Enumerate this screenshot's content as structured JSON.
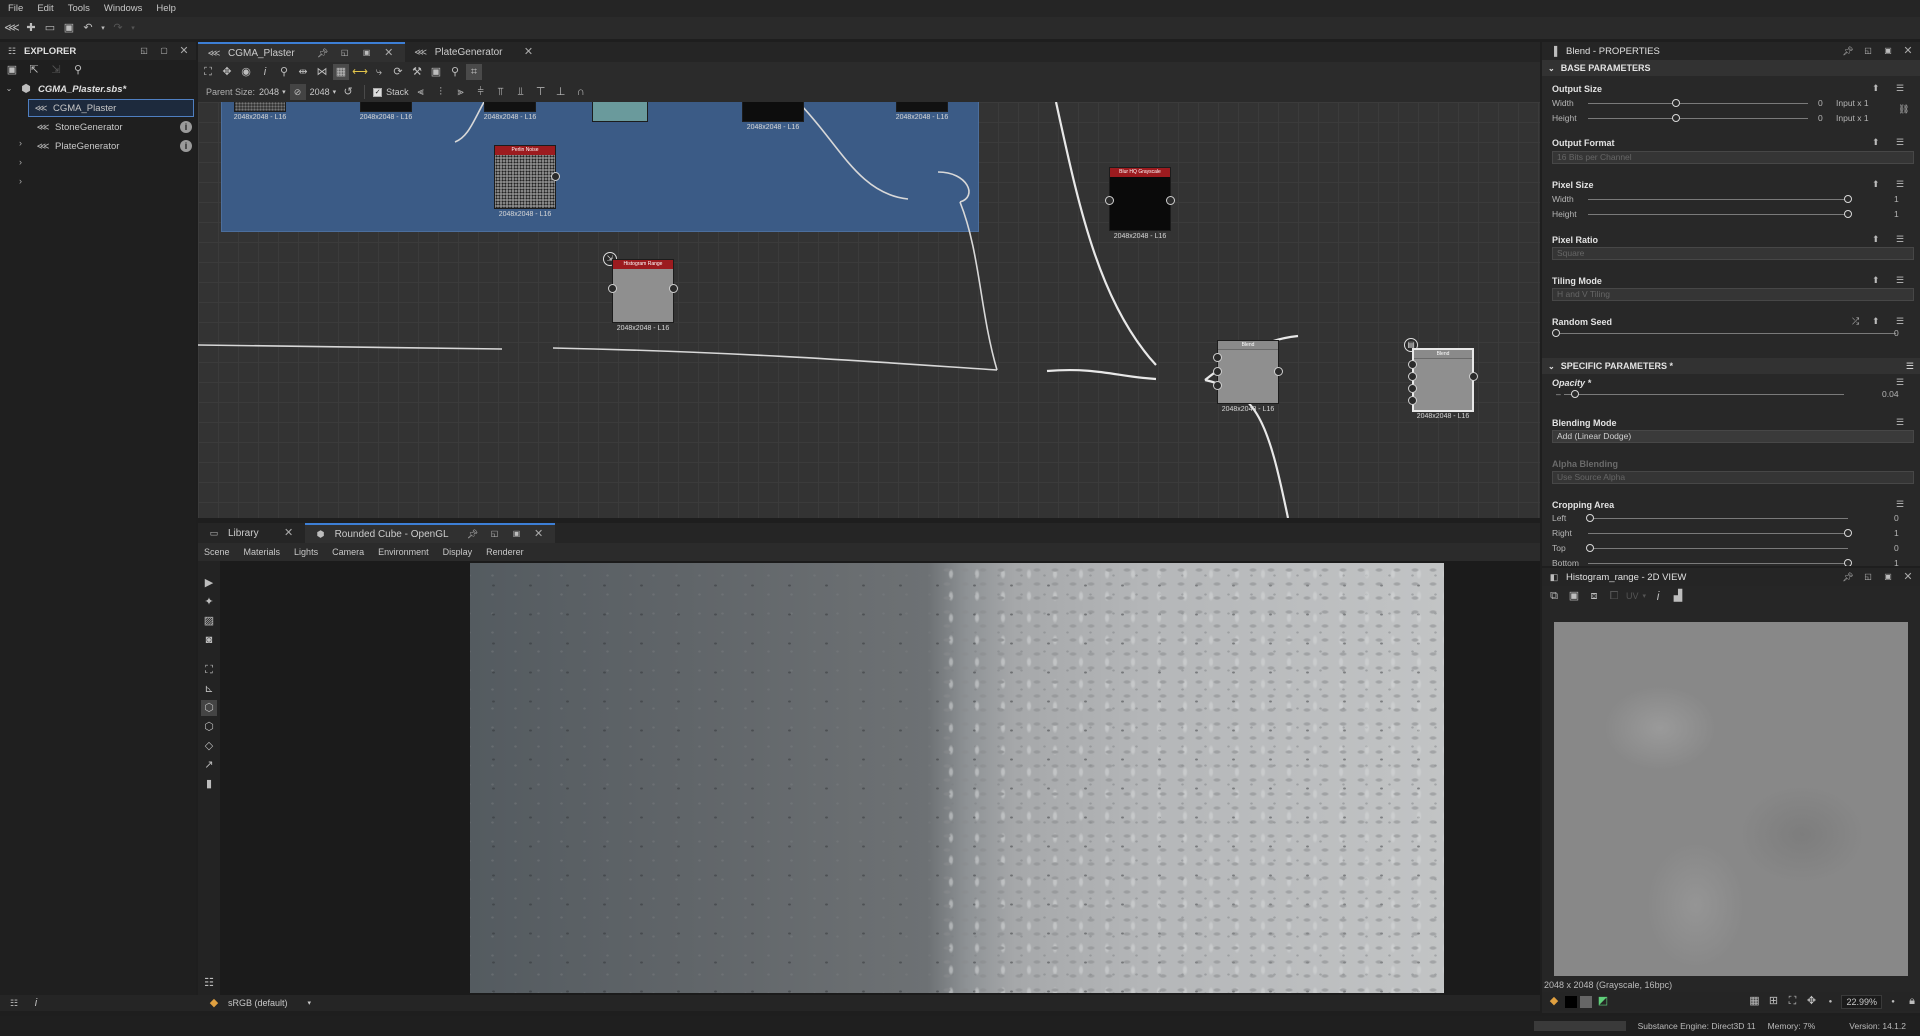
{
  "menu": [
    "File",
    "Edit",
    "Tools",
    "Windows",
    "Help"
  ],
  "explorer": {
    "title": "EXPLORER",
    "package": "CGMA_Plaster.sbs*",
    "items": [
      "CGMA_Plaster",
      "StoneGenerator",
      "PlateGenerator"
    ]
  },
  "graph": {
    "tabs": [
      "CGMA_Plaster",
      "PlateGenerator"
    ],
    "parent_size_label": "Parent Size:",
    "parent_size_value": "2048",
    "size_value": "2048",
    "stack_label": "Stack",
    "nodes": {
      "top1_cap": "2048x2048 - L16",
      "top2_cap": "2048x2048 - L16",
      "top3_cap": "2048x2048 - L16",
      "top4_cap": "2048x2048 - L16",
      "top5_cap": "2048x2048 - L16",
      "perlin_title": "Perlin Noise",
      "perlin_cap": "2048x2048 - L16",
      "blur_title": "Blur HQ Grayscale",
      "blur_cap": "2048x2048 - L16",
      "histo_title": "Histogram Range",
      "histo_cap": "2048x2048 - L16",
      "blend1_title": "Blend",
      "blend1_cap": "2048x2048 - L16",
      "blend2_title": "Blend",
      "blend2_cap": "2048x2048 - L16"
    }
  },
  "viewport": {
    "tabs": [
      "Library",
      "Rounded Cube - OpenGL"
    ],
    "menu": [
      "Scene",
      "Materials",
      "Lights",
      "Camera",
      "Environment",
      "Display",
      "Renderer"
    ],
    "colorspace": "sRGB (default)"
  },
  "properties": {
    "title": "Blend - PROPERTIES",
    "base_section": "BASE PARAMETERS",
    "output_size": {
      "label": "Output Size",
      "width_label": "Width",
      "height_label": "Height",
      "width_value": "0",
      "height_value": "0",
      "width_mode": "Input x 1",
      "height_mode": "Input x 1"
    },
    "output_format": {
      "label": "Output Format",
      "value": "16 Bits per Channel"
    },
    "pixel_size": {
      "label": "Pixel Size",
      "width_label": "Width",
      "height_label": "Height",
      "width_value": "1",
      "height_value": "1"
    },
    "pixel_ratio": {
      "label": "Pixel Ratio",
      "value": "Square"
    },
    "tiling_mode": {
      "label": "Tiling Mode",
      "value": "H and V Tiling"
    },
    "random_seed": {
      "label": "Random Seed",
      "value": "0"
    },
    "specific_section": "SPECIFIC PARAMETERS *",
    "opacity": {
      "label": "Opacity *",
      "value": "0.04",
      "fraction": 0.04
    },
    "blending_mode": {
      "label": "Blending Mode",
      "value": "Add (Linear Dodge)"
    },
    "alpha_blending": {
      "label": "Alpha Blending",
      "value": "Use Source Alpha"
    },
    "cropping": {
      "label": "Cropping Area",
      "left_label": "Left",
      "right_label": "Right",
      "top_label": "Top",
      "bottom_label": "Bottom",
      "left_value": "0",
      "right_value": "1",
      "top_value": "0",
      "bottom_value": "1"
    }
  },
  "view2d": {
    "title": "Histogram_range - 2D VIEW",
    "uv_label": "UV",
    "info": "2048 x 2048 (Grayscale, 16bpc)",
    "zoom": "22.99%"
  },
  "status": {
    "engine": "Substance Engine: Direct3D 11",
    "memory": "Memory: 7%",
    "version": "Version: 14.1.2"
  }
}
